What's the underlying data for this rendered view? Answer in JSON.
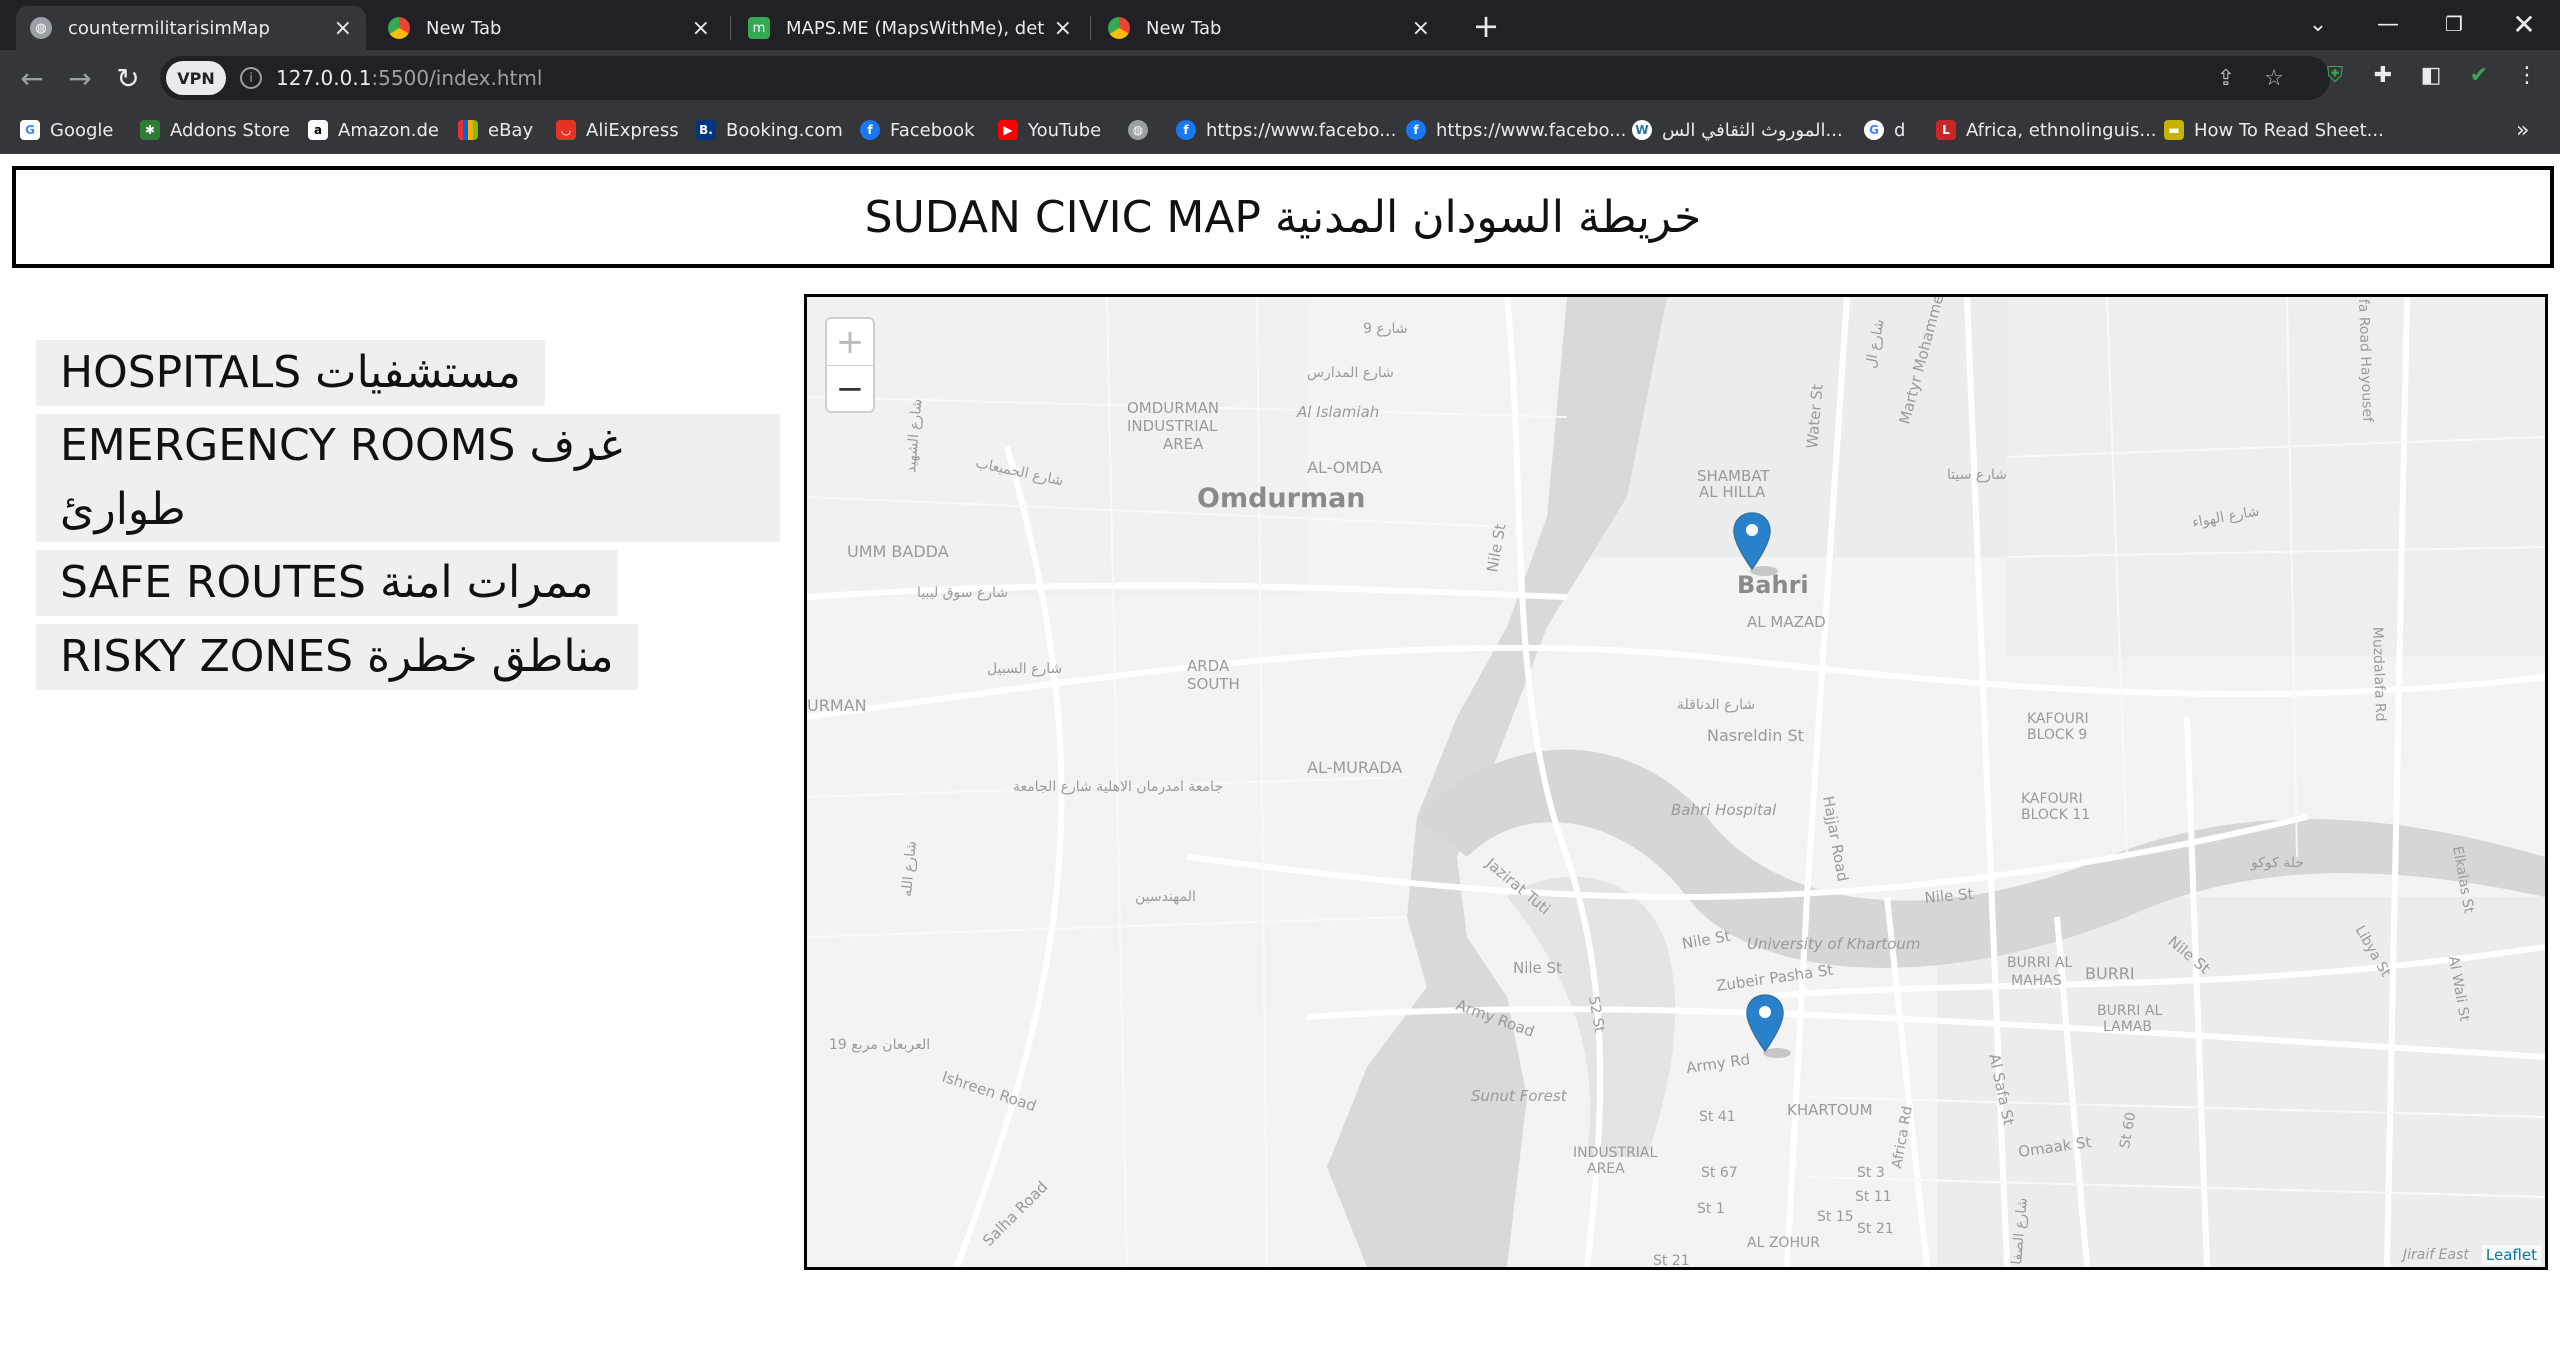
{
  "tabs": [
    {
      "title": "countermilitarisimMap",
      "favicon": "globe-icon",
      "active": true
    },
    {
      "title": "New Tab",
      "favicon": "chrome-icon",
      "active": false
    },
    {
      "title": "MAPS.ME (MapsWithMe), detaile",
      "favicon": "mapsme-icon",
      "active": false
    },
    {
      "title": "New Tab",
      "favicon": "chrome-icon",
      "active": false
    }
  ],
  "toolbar": {
    "vpn_label": "VPN",
    "url_host": "127.0.0.1",
    "url_path": ":5500/index.html"
  },
  "bookmarks": [
    {
      "label": "Google",
      "icon": "google-icon",
      "color": "#ffffff"
    },
    {
      "label": "Addons Store",
      "icon": "addons-icon",
      "color": "#2e7d32"
    },
    {
      "label": "Amazon.de",
      "icon": "amazon-icon",
      "color": "#ffffff"
    },
    {
      "label": "eBay",
      "icon": "ebay-icon",
      "color": "#e53238"
    },
    {
      "label": "AliExpress",
      "icon": "aliexpress-icon",
      "color": "#e43225"
    },
    {
      "label": "Booking.com",
      "icon": "booking-icon",
      "color": "#003580"
    },
    {
      "label": "Facebook",
      "icon": "facebook-icon",
      "color": "#1877f2"
    },
    {
      "label": "YouTube",
      "icon": "youtube-icon",
      "color": "#ff0000"
    },
    {
      "label": "",
      "icon": "globe-icon",
      "color": "#9aa0a6"
    },
    {
      "label": "https://www.facebo...",
      "icon": "facebook-icon",
      "color": "#1877f2"
    },
    {
      "label": "https://www.facebo...",
      "icon": "facebook-icon",
      "color": "#1877f2"
    },
    {
      "label": "الموروث الثقافي الس...",
      "icon": "wordpress-icon",
      "color": "#ffffff"
    },
    {
      "label": "d",
      "icon": "google-icon",
      "color": "#ffffff"
    },
    {
      "label": "Africa, ethnolinguis...",
      "icon": "loc-icon",
      "color": "#c62828"
    },
    {
      "label": "How To Read Sheet...",
      "icon": "sheet-icon",
      "color": "#c9b100"
    }
  ],
  "page": {
    "title": "SUDAN CIVIC MAP خريطة السودان المدنية"
  },
  "menu": [
    {
      "label": "HOSPITALS مستشفيات"
    },
    {
      "label": "EMERGENCY ROOMS غرف طوارئ"
    },
    {
      "label": "SAFE ROUTES ممرات امنة"
    },
    {
      "label": "RISKY ZONES مناطق خطرة"
    }
  ],
  "map": {
    "zoom_in": "+",
    "zoom_out": "−",
    "attribution": "Leaflet",
    "marker_color": "#2a81cb",
    "labels": {
      "omdurman": "Omdurman",
      "bahri": "Bahri",
      "shambat": "SHAMBAT",
      "al_hilla": "AL HILLA",
      "al_mazad": "AL MAZAD",
      "umm_badda": "UMM BADDA",
      "omdurman_industrial": "OMDURMAN",
      "industrial": "INDUSTRIAL",
      "area": "AREA",
      "al_omda": "AL-OMDA",
      "arda": "ARDA",
      "south": "SOUTH",
      "al_murada": "AL-MURADA",
      "urman": "URMAN",
      "al_islamiah": "Al Islamiah",
      "nile_st": "Nile St",
      "nile_st2": "Nile St",
      "nile_st3": "Nile St",
      "nile_st4": "Nile St",
      "nile_st5": "Nile St",
      "water_st": "Water St",
      "martyr": "Martyr Mohamme",
      "hajjar": "Hajjar Road",
      "nasreldin": "Nasreldin St",
      "bahri_hospital": "Bahri Hospital",
      "kafouri9": "KAFOURI",
      "block9": "BLOCK 9",
      "kafouri11": "KAFOURI",
      "block11": "BLOCK 11",
      "univ": "University of Khartoum",
      "zubeir": "Zubeir Pasha St",
      "army_rd": "Army Rd",
      "army_road": "Army Road",
      "jazirat": "Jazirat Tuti",
      "burri_mahas": "BURRI AL",
      "mahas": "MAHAS",
      "burri": "BURRI",
      "burri_lamab": "BURRI AL",
      "lamab": "LAMAB",
      "sunut": "Sunut Forest",
      "khartoum": "KHARTOUM",
      "industrial_area": "INDUSTRIAL",
      "industrial_area2": "AREA",
      "ishreen": "Ishreen Road",
      "salha": "Salha Road",
      "st41": "St 41",
      "st67": "St 67",
      "st1": "St 1",
      "st3": "St 3",
      "st11": "St 11",
      "st15": "St 15",
      "st21": "St 21",
      "st21b": "St 21",
      "st52": "52 St",
      "africa_rd": "Africa Rd",
      "al_safa": "Al Safa St",
      "omaak": "Omaak St",
      "st60": "St 60",
      "al_zohur": "AL ZOHUR",
      "libya": "Libya St",
      "elkalas": "Elkalas St",
      "al_wali": "Al Wali St",
      "muzdalafa": "Muzdalafa Rd",
      "hayousef": "fa Road Hayousef",
      "jiraif": "Jiraif East",
      "ar_madaris": "شارع المدارس",
      "ar_9": "شارع 9",
      "ar_juma": "شارع الجميعاب",
      "ar_souq": "شارع سوق ليبيا",
      "ar_sabil": "شارع السبيل",
      "ar_jamia": "جامعة امدرمان الاهلية  شارع الجامعة",
      "ar_muhandisin": "المهندسين",
      "ar_urbain": "العربعان مربع 19",
      "ar_dananqla": "شارع الدناقلة",
      "ar_sitta": "شارع سيتا",
      "ar_hawa": "شارع الهواء",
      "ar_kuku": "حلة كوكو",
      "ar_ahad": "شارع الشهيد",
      "ar_alla": "شارع الله",
      "ar_shamb": "شارع ال",
      "ar_safa2": "شارع الصفا"
    }
  }
}
